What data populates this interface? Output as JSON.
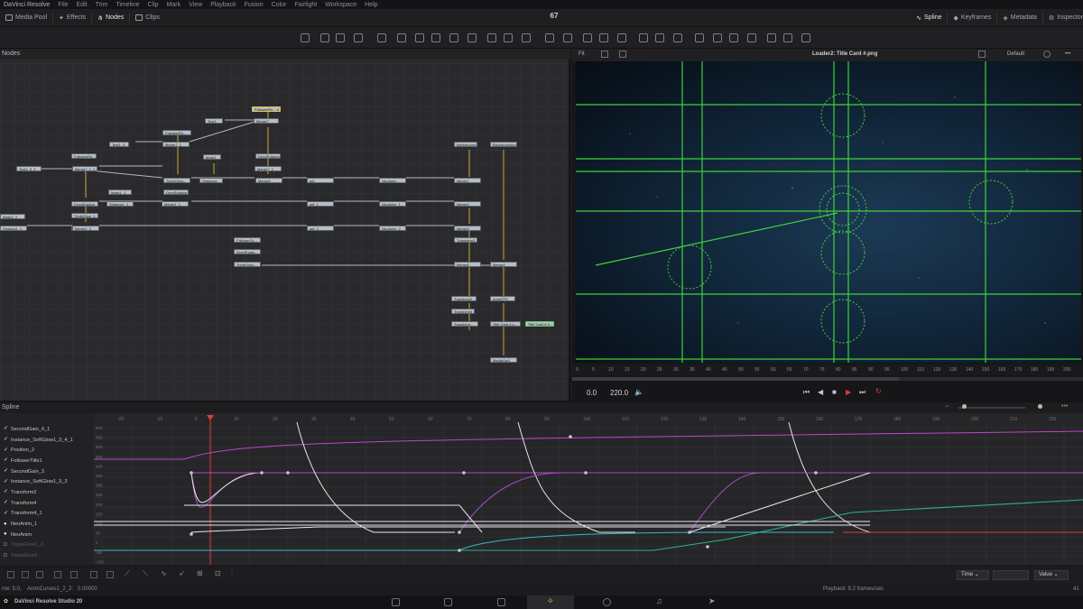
{
  "app": {
    "title": "DaVinci Resolve",
    "version_label": "DaVinci Resolve Studio 20"
  },
  "menu": [
    "File",
    "Edit",
    "Trim",
    "Timeline",
    "Clip",
    "Mark",
    "View",
    "Playback",
    "Fusion",
    "Color",
    "Fairlight",
    "Workspace",
    "Help"
  ],
  "toolbar": {
    "left": [
      {
        "label": "Media Pool",
        "icon": "media-pool-icon"
      },
      {
        "label": "Effects",
        "icon": "effects-icon"
      },
      {
        "label": "Nodes",
        "icon": "nodes-icon",
        "active": true
      },
      {
        "label": "Clips",
        "icon": "clips-icon"
      }
    ],
    "frame": "67",
    "right": [
      {
        "label": "Spline",
        "icon": "spline-icon",
        "active": true
      },
      {
        "label": "Keyframes",
        "icon": "keyframes-icon"
      },
      {
        "label": "Metadata",
        "icon": "metadata-icon"
      },
      {
        "label": "Inspector",
        "icon": "inspector-icon"
      }
    ]
  },
  "nodes_panel": {
    "title": "Nodes",
    "nodes": [
      {
        "label": "FollowerRo... 4",
        "sel": true
      },
      {
        "label": "Text1"
      },
      {
        "label": "Merge7"
      },
      {
        "label": "FollowerRo..."
      },
      {
        "label": "Text1_3"
      },
      {
        "label": "Merge7_1"
      },
      {
        "label": "DropShadow4"
      },
      {
        "label": "FollowerRo..."
      },
      {
        "label": "Text1_3_1"
      },
      {
        "label": "Merge7_1_1"
      },
      {
        "label": "Mask1"
      },
      {
        "label": "Merge7_1"
      },
      {
        "label": "TripleGlow..."
      },
      {
        "label": "DropShadow..."
      },
      {
        "label": "Shadow1"
      },
      {
        "label": "Merge8"
      },
      {
        "label": "adj"
      },
      {
        "label": "NeoAnim"
      },
      {
        "label": "Merge1"
      },
      {
        "label": "Background1"
      },
      {
        "label": "Backgroundcol..."
      },
      {
        "label": "DropShadow_1"
      },
      {
        "label": "TripleGlow_1"
      },
      {
        "label": "Mask1_1"
      },
      {
        "label": "Shadow1_1"
      },
      {
        "label": "Merge1_1"
      },
      {
        "label": "adj_1"
      },
      {
        "label": "NeoAnim_1"
      },
      {
        "label": "Merge2"
      },
      {
        "label": "TripleGlow..."
      },
      {
        "label": "Mask2_2"
      },
      {
        "label": "Shadow1_2"
      },
      {
        "label": "Merge1_2"
      },
      {
        "label": "adj_2"
      },
      {
        "label": "NeoAnim_2"
      },
      {
        "label": "Merge3"
      },
      {
        "label": "Transform3"
      },
      {
        "label": "FollowerTo..."
      },
      {
        "label": "DropShado..."
      },
      {
        "label": "TripleGlow..."
      },
      {
        "label": "Merge6"
      },
      {
        "label": "Merge4"
      },
      {
        "label": "Transform2"
      },
      {
        "label": "AnimFPS"
      },
      {
        "label": "Transform4"
      },
      {
        "label": "Transform..."
      },
      {
        "label": "Title Card #.p..."
      },
      {
        "label": "Title Card #.p...",
        "grn": true
      },
      {
        "label": "MediaOut1"
      }
    ]
  },
  "viewer": {
    "fit_label": "Fit",
    "title": "Loader2: Title Card #.png",
    "default_label": "Default",
    "ruler_ticks": [
      "0",
      "5",
      "10",
      "15",
      "20",
      "25",
      "30",
      "35",
      "40",
      "45",
      "50",
      "55",
      "60",
      "65",
      "70",
      "75",
      "80",
      "85",
      "90",
      "95",
      "100",
      "110",
      "120",
      "130",
      "140",
      "150",
      "160",
      "170",
      "180",
      "190",
      "200"
    ],
    "time_in": "0.0",
    "time_out": "220.0"
  },
  "spline": {
    "title": "Spline",
    "ruler_ticks": [
      "-20",
      "-10",
      "0",
      "10",
      "20",
      "30",
      "40",
      "50",
      "60",
      "70",
      "80",
      "90",
      "100",
      "110",
      "120",
      "130",
      "140",
      "150",
      "160",
      "170",
      "180",
      "190",
      "200",
      "210",
      "220",
      "230"
    ],
    "value_ticks": [
      "600",
      "550",
      "500",
      "450",
      "400",
      "350",
      "300",
      "250",
      "200",
      "150",
      "100",
      "50",
      "0",
      "-50",
      "-100"
    ],
    "tracks": [
      {
        "label": "SecondGain_4_1",
        "checked": true
      },
      {
        "label": "Instance_SoftGlow1_3_4_1",
        "checked": true
      },
      {
        "label": "Position_2",
        "checked": true
      },
      {
        "label": "FollowerTitle1",
        "checked": true
      },
      {
        "label": "SecondGain_3",
        "checked": true
      },
      {
        "label": "Instance_SoftGlow1_3_3",
        "checked": true
      },
      {
        "label": "Transform2",
        "checked": true
      },
      {
        "label": "Transform4",
        "checked": true
      },
      {
        "label": "Transform4_1",
        "checked": true
      },
      {
        "label": "NeoAnim_1",
        "checked": false
      },
      {
        "label": "NeoAnim",
        "checked": false
      },
      {
        "label": "TripleGlow1_3",
        "checked": false,
        "dim": true
      },
      {
        "label": "TripleGlow1",
        "checked": false,
        "dim": true
      }
    ],
    "time_dropdown": "Time",
    "value_dropdown": "Value"
  },
  "status": {
    "left_prefix": "me: 5.0,",
    "curve": "AnimCurves1_2_2:",
    "value": "0.00000",
    "playback": "Playback: 9.2 frames/sec",
    "right": "41"
  },
  "pages": [
    "media-page-icon",
    "cut-page-icon",
    "edit-page-icon",
    "fusion-page-icon",
    "color-page-icon",
    "fairlight-page-icon",
    "deliver-page-icon"
  ]
}
